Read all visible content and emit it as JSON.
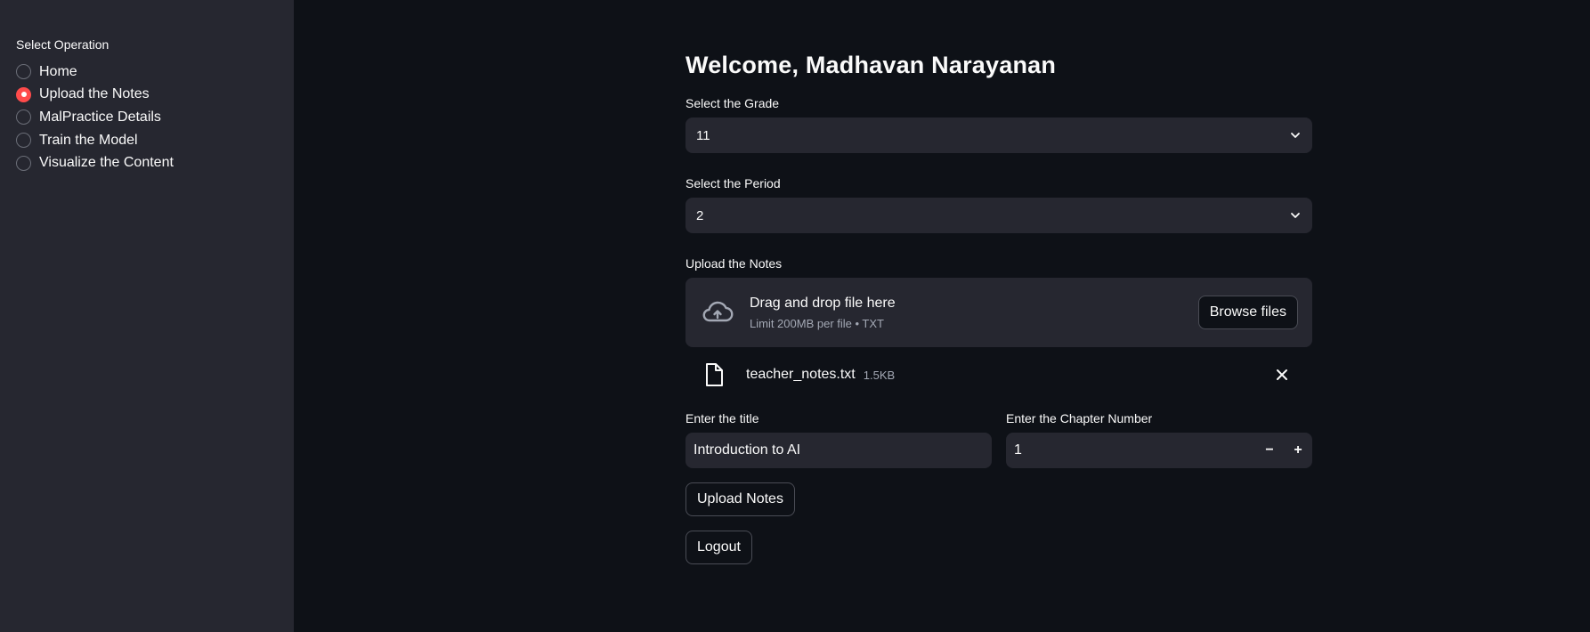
{
  "sidebar": {
    "label": "Select Operation",
    "options": [
      "Home",
      "Upload the Notes",
      "MalPractice Details",
      "Train the Model",
      "Visualize the Content"
    ],
    "selected_index": 1
  },
  "main": {
    "title": "Welcome, Madhavan Narayanan",
    "grade": {
      "label": "Select the Grade",
      "value": "11"
    },
    "period": {
      "label": "Select the Period",
      "value": "2"
    },
    "upload": {
      "label": "Upload the Notes",
      "drop_text": "Drag and drop file here",
      "limit_text": "Limit 200MB per file • TXT",
      "browse_label": "Browse files",
      "file_name": "teacher_notes.txt",
      "file_size": "1.5KB"
    },
    "title_field": {
      "label": "Enter the title",
      "value": "Introduction to AI"
    },
    "chapter_field": {
      "label": "Enter the Chapter Number",
      "value": "1"
    },
    "upload_button": "Upload Notes",
    "logout_button": "Logout"
  },
  "colors": {
    "accent": "#ff4b4b",
    "background": "#0e1117",
    "panel": "#262730"
  }
}
